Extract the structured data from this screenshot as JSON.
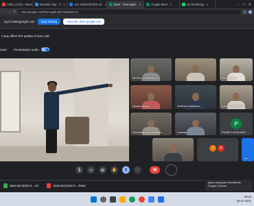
{
  "browser": {
    "tabs": [
      {
        "label": "Video (1/43) - shark",
        "active": false,
        "color": "#ea4335"
      },
      {
        "label": "Republic day - C",
        "active": false,
        "color": "#4285f4"
      },
      {
        "label": "11C HUMANITIES 20:",
        "active": false,
        "color": "#1a73e8"
      },
      {
        "label": "Meet - how-wgxh-",
        "active": true,
        "color": "#00897b"
      },
      {
        "label": "Google Meet",
        "active": false,
        "color": "#00897b"
      },
      {
        "label": "(2) WhatsApp",
        "active": false,
        "color": "#25d366"
      }
    ],
    "url": "meet.google.com/how-wgxh-pso?authuser=0",
    "window_controls": [
      "–",
      "□",
      "✕"
    ]
  },
  "share_bar": {
    "message": "ng to meet.google.com",
    "stop_label": "Stop sharing",
    "view_label": "View tab: drive.google.com"
  },
  "warning": "t may affect the quality of your call",
  "audio_row": {
    "left_label": "rome",
    "audio_label": "Presentation audio"
  },
  "participants": [
    {
      "name": "MRITIKA SHARMA 11..."
    },
    {
      "name": ""
    },
    {
      "name": "ZIAH SINGH"
    },
    {
      "name": "Navisha Singh"
    },
    {
      "name": "SIMRAN DAWRAN..."
    },
    {
      "name": "KANIKA SHARMA"
    },
    {
      "name": "Venkatasamhita Venkata..."
    },
    {
      "name": "Lavanya ..."
    },
    {
      "name": "PRABITI KONDURU",
      "initial": "P"
    },
    {
      "name": ""
    },
    {
      "name": "",
      "initials": [
        "S",
        "R"
      ]
    },
    {
      "name": "You"
    }
  ],
  "controls": {
    "icons": [
      "mic-icon",
      "camera-icon",
      "captions-icon",
      "raise-hand-icon",
      "present-icon",
      "more-icon",
      "end-call-icon"
    ]
  },
  "toast": {
    "line1": "Apps using your microphone",
    "line2": "Google Chrome"
  },
  "downloads": [
    {
      "label": "class-6xl-(2022-0....cm",
      "type": "sheet"
    },
    {
      "label": "class-6xl-(2022-0-...iMmd",
      "type": "pdf"
    }
  ],
  "taskbar": {
    "time": "09:34",
    "date": "26-01-2022"
  }
}
